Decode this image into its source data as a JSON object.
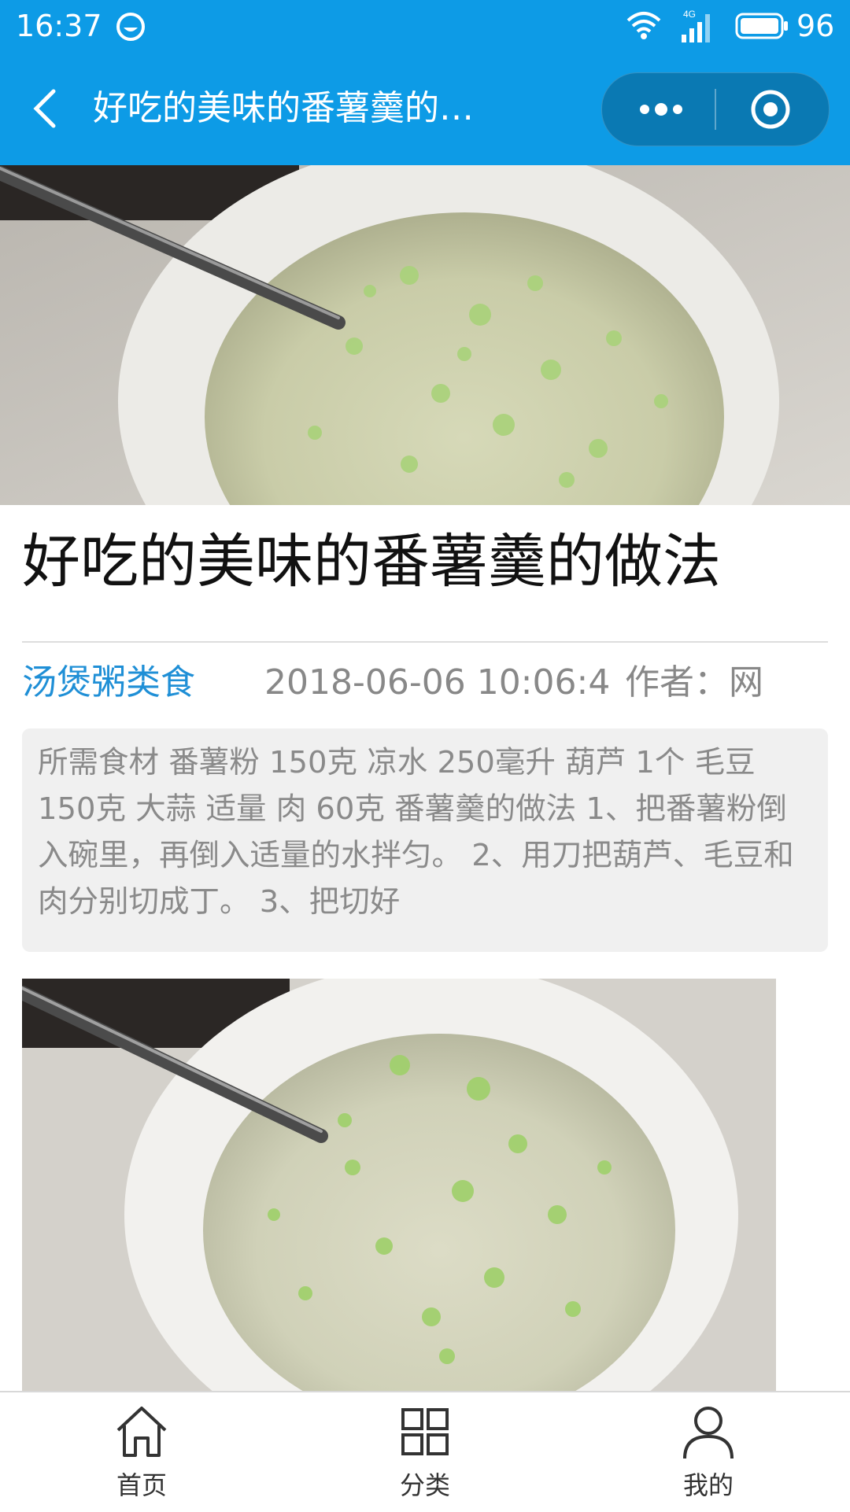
{
  "status_bar": {
    "time": "16:37",
    "network": "4G",
    "battery": "96"
  },
  "nav": {
    "title": "好吃的美味的番薯羹的…"
  },
  "article": {
    "title": "好吃的美味的番薯羹的做法",
    "category": "汤煲粥类食",
    "date": "2018-06-06 10:06:4",
    "author": "作者：网",
    "summary": "所需食材 番薯粉 150克 凉水 250毫升 葫芦 1个 毛豆 150克 大蒜 适量 肉 60克 番薯羹的做法 1、把番薯粉倒入碗里，再倒入适量的水拌匀。 2、用刀把葫芦、毛豆和肉分别切成丁。 3、把切好"
  },
  "tabbar": {
    "items": [
      {
        "label": "首页",
        "icon": "home-icon"
      },
      {
        "label": "分类",
        "icon": "grid-icon"
      },
      {
        "label": "我的",
        "icon": "user-icon"
      }
    ]
  },
  "colors": {
    "primary": "#0d9be6",
    "category": "#1f8fd6",
    "meta": "#888888",
    "summary_bg": "#f0f0f0"
  }
}
